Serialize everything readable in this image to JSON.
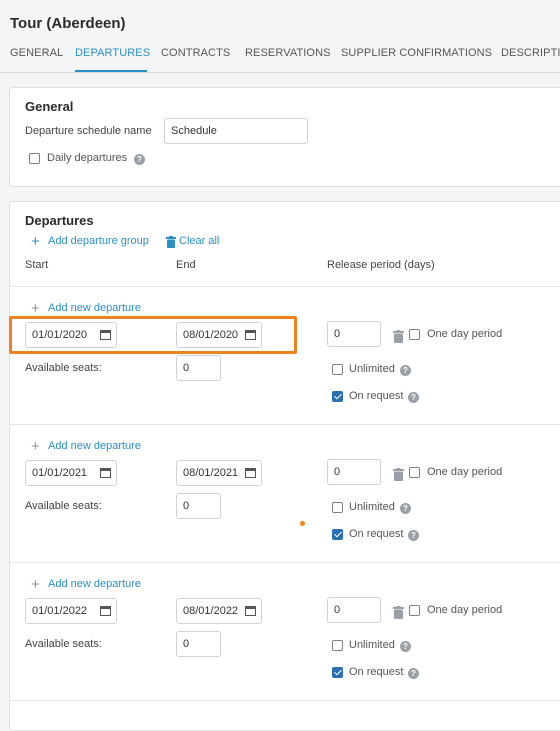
{
  "page": {
    "title": "Tour (Aberdeen)"
  },
  "tabs": [
    {
      "label": "GENERAL"
    },
    {
      "label": "DEPARTURES"
    },
    {
      "label": "CONTRACTS"
    },
    {
      "label": "RESERVATIONS"
    },
    {
      "label": "SUPPLIER CONFIRMATIONS"
    },
    {
      "label": "DESCRIPTIC"
    }
  ],
  "general": {
    "heading": "General",
    "schedule_label": "Departure schedule name",
    "schedule_value": "Schedule",
    "daily_label": "Daily departures",
    "daily_checked": false
  },
  "departures": {
    "heading": "Departures",
    "add_group": "Add departure group",
    "clear_all": "Clear all",
    "col_start": "Start",
    "col_end": "End",
    "col_release": "Release period (days)",
    "groups": [
      {
        "add_new": "Add new departure",
        "start": "01/01/2020",
        "end": "08/01/2020",
        "release": "0",
        "one_day": "One day period",
        "seats_label": "Available seats:",
        "seats": "0",
        "unlimited": "Unlimited",
        "on_request": "On request"
      },
      {
        "add_new": "Add new departure",
        "start": "01/01/2021",
        "end": "08/01/2021",
        "release": "0",
        "one_day": "One day period",
        "seats_label": "Available seats:",
        "seats": "0",
        "unlimited": "Unlimited",
        "on_request": "On request"
      },
      {
        "add_new": "Add new departure",
        "start": "01/01/2022",
        "end": "08/01/2022",
        "release": "0",
        "one_day": "One day period",
        "seats_label": "Available seats:",
        "seats": "0",
        "unlimited": "Unlimited",
        "on_request": "On request"
      }
    ]
  },
  "colors": {
    "accent": "#2a8fc7",
    "highlight": "#f0821e",
    "checkbox": "#2a6fb3"
  },
  "icons": {
    "calendar": "calendar-icon",
    "trash": "trash-icon",
    "help": "help-icon",
    "plus": "plus-icon"
  }
}
